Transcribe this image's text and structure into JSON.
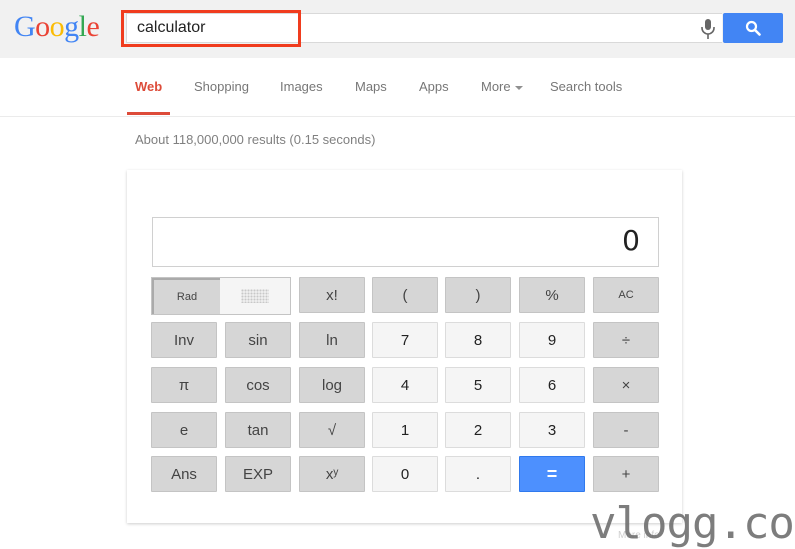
{
  "header": {
    "logo_letters": [
      {
        "ch": "G",
        "color": "#4285f4"
      },
      {
        "ch": "o",
        "color": "#ea4335"
      },
      {
        "ch": "o",
        "color": "#fbbc05"
      },
      {
        "ch": "g",
        "color": "#4285f4"
      },
      {
        "ch": "l",
        "color": "#34a853"
      },
      {
        "ch": "e",
        "color": "#ea4335"
      }
    ],
    "search_value": "calculator",
    "mic_icon": "microphone-icon",
    "search_icon": "magnifier-icon"
  },
  "nav": {
    "items": [
      {
        "label": "Web",
        "active": true
      },
      {
        "label": "Shopping"
      },
      {
        "label": "Images"
      },
      {
        "label": "Maps"
      },
      {
        "label": "Apps"
      },
      {
        "label": "More"
      },
      {
        "label": "Search tools"
      }
    ]
  },
  "results": {
    "stats": "About 118,000,000 results (0.15 seconds)"
  },
  "calculator": {
    "display": "0",
    "mode_rad": "Rad",
    "rows": [
      [
        {
          "label": "x!",
          "type": "fn"
        },
        {
          "label": "(",
          "type": "fn"
        },
        {
          "label": ")",
          "type": "fn"
        },
        {
          "label": "%",
          "type": "fn"
        },
        {
          "label": "AC",
          "type": "fn small"
        }
      ],
      [
        {
          "label": "Inv",
          "type": "fn"
        },
        {
          "label": "sin",
          "type": "fn"
        },
        {
          "label": "ln",
          "type": "fn"
        },
        {
          "label": "7",
          "type": "num"
        },
        {
          "label": "8",
          "type": "num"
        },
        {
          "label": "9",
          "type": "num"
        },
        {
          "label": "÷",
          "type": "fn"
        }
      ],
      [
        {
          "label": "π",
          "type": "fn"
        },
        {
          "label": "cos",
          "type": "fn"
        },
        {
          "label": "log",
          "type": "fn"
        },
        {
          "label": "4",
          "type": "num"
        },
        {
          "label": "5",
          "type": "num"
        },
        {
          "label": "6",
          "type": "num"
        },
        {
          "label": "×",
          "type": "fn"
        }
      ],
      [
        {
          "label": "e",
          "type": "fn"
        },
        {
          "label": "tan",
          "type": "fn"
        },
        {
          "label": "√",
          "type": "fn"
        },
        {
          "label": "1",
          "type": "num"
        },
        {
          "label": "2",
          "type": "num"
        },
        {
          "label": "3",
          "type": "num"
        },
        {
          "label": "-",
          "type": "fn"
        }
      ],
      [
        {
          "label": "Ans",
          "type": "fn"
        },
        {
          "label": "EXP",
          "type": "fn"
        },
        {
          "label": "xʸ",
          "type": "fn"
        },
        {
          "label": "0",
          "type": "num"
        },
        {
          "label": ".",
          "type": "num"
        },
        {
          "label": "=",
          "type": "eq"
        },
        {
          "label": "+",
          "type": "fn"
        }
      ]
    ],
    "more_info": "More info"
  },
  "watermark": "vlogg.com"
}
